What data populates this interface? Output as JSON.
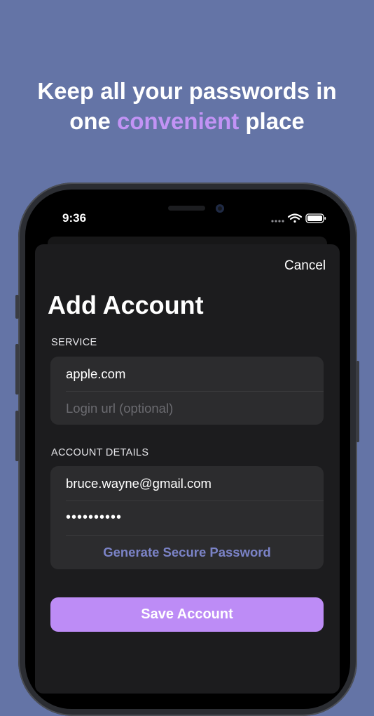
{
  "promo": {
    "line1": "Keep all your passwords in",
    "line2_before": "one ",
    "line2_accent": "convenient",
    "line2_after": " place",
    "accent_color": "#c293f5",
    "background_color": "#6474a6"
  },
  "status_bar": {
    "time": "9:36",
    "icons": [
      "signal-icon",
      "wifi-icon",
      "battery-icon"
    ]
  },
  "sheet": {
    "cancel_label": "Cancel",
    "title": "Add Account",
    "service": {
      "label": "SERVICE",
      "service_value": "apple.com",
      "login_url_value": "",
      "login_url_placeholder": "Login url (optional)"
    },
    "account_details": {
      "label": "ACCOUNT DETAILS",
      "email_value": "bruce.wayne@gmail.com",
      "password_masked": "••••••••••",
      "generate_label": "Generate Secure Password"
    },
    "save_label": "Save Account",
    "save_color": "#bd8cf6"
  }
}
